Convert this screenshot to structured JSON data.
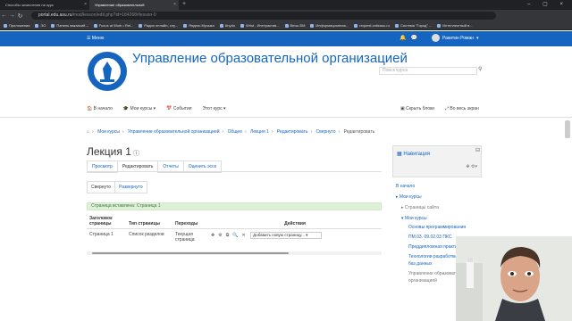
{
  "browser": {
    "tabs": [
      {
        "title": "Способы зачисления на курс",
        "active": false
      },
      {
        "title": "Управление образовательной",
        "active": true
      }
    ],
    "url_domain": "portal.edu.asu.ru",
    "url_path": "/mod/lesson/edit.php?id=184268#lesson-0",
    "bookmarks": [
      "Приложения",
      "ЭО",
      "Панель вакансий –",
      "Focus at Work • Rel...",
      "Радио онлайн, слу...",
      "Яндекс.Музыка",
      "Anydo",
      "Wrist - Интерактив...",
      "Весы ВМ",
      "Информационная...",
      "request.cnitcasu.ru",
      "Система \"Город\" ...",
      "Интеллектный в..."
    ]
  },
  "topbar": {
    "menu_label": "Меню",
    "user_name": "Ракитин Роман"
  },
  "header": {
    "site_title": "Управление образовательной организацией",
    "search_placeholder": "Поиск курса"
  },
  "subnav": {
    "home": "В начало",
    "my_courses": "Мои курсы",
    "events": "События",
    "this_course": "Этот курс",
    "hide_blocks": "Скрыть блоки",
    "fullscreen": "Во весь экран"
  },
  "breadcrumb": [
    "Мои курсы",
    "Управление образовательной организацией",
    "Общее",
    "Лекция 1",
    "Редактировать",
    "Свернуто",
    "Редактировать"
  ],
  "page_title": "Лекция 1",
  "lesson_tabs": [
    "Просмотр",
    "Редактировать",
    "Отчеты",
    "Оценить эссе"
  ],
  "view_tabs": [
    "Свернуто",
    "Развернуто"
  ],
  "alert_text": "Страница вставлена: Страница 1",
  "table": {
    "headers": [
      "Заголовок страницы",
      "Тип страницы",
      "Переходы",
      "Действия"
    ],
    "rows": [
      {
        "title": "Страница 1",
        "type": "Список разделов",
        "jumps": "Текущая страница",
        "add_select": "Добавить новую страницу..."
      }
    ]
  },
  "navigation": {
    "title": "Навигация",
    "items": [
      {
        "label": "В начало",
        "level": 0
      },
      {
        "label": "Мои курсы",
        "level": 0
      },
      {
        "label": "Страницы сайта",
        "level": 1
      },
      {
        "label": "Мои курсы",
        "level": 1
      },
      {
        "label": "Основы программирования",
        "level": 2
      },
      {
        "label": "ПМ 03. 09.02.03 ПКС",
        "level": 2
      },
      {
        "label": "Преддипломная практика ПКС",
        "level": 2
      },
      {
        "label": "Технологии разработки защиты баз данных",
        "level": 2
      },
      {
        "label": "Управление образовательной организацией",
        "level": 2
      }
    ]
  },
  "colors": {
    "brand_blue": "#1565c0",
    "alert_bg": "#dff0d8",
    "browser_dark": "#202124"
  }
}
